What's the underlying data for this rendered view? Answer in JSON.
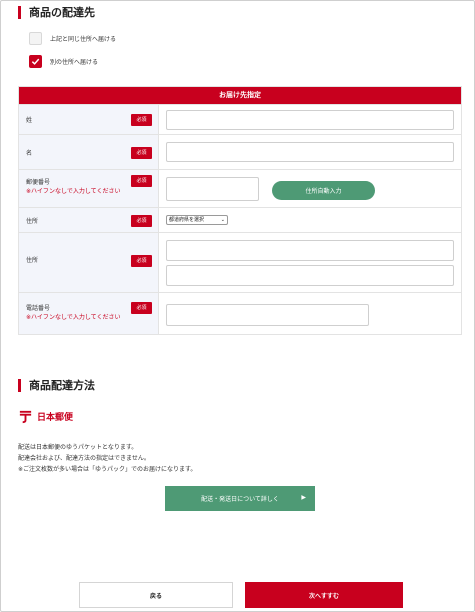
{
  "section1": {
    "title": "商品の配達先",
    "options": [
      {
        "label": "上記と同じ住所へ届ける",
        "checked": false
      },
      {
        "label": "別の住所へ届ける",
        "checked": true
      }
    ]
  },
  "form": {
    "header": "お届け先指定",
    "required_label": "必須",
    "rows": [
      {
        "label": "姓",
        "note": "",
        "value": ""
      },
      {
        "label": "名",
        "note": "",
        "value": ""
      },
      {
        "label": "郵便番号",
        "note": "※ハイフンなしで入力してください",
        "value": "",
        "button": "住所自動入力"
      },
      {
        "label": "住所",
        "note": "",
        "select": "都道府県を選択"
      },
      {
        "label": "住所",
        "note": "",
        "value1": "",
        "value2": ""
      },
      {
        "label": "電話番号",
        "note": "※ハイフンなしで入力してください",
        "value": ""
      }
    ]
  },
  "section2": {
    "title": "商品配達方法",
    "logo_text": "日本郵便",
    "info": [
      "配送は日本郵便のゆうパケットとなります。",
      "配達会社および、配達方法の指定はできません。",
      "※ご注文枚数が多い場合は「ゆうパック」でのお届けになります。"
    ],
    "detail_button": "配送・発送日について詳しく"
  },
  "footer": {
    "back_label": "戻る",
    "next_label": "次へすすむ"
  },
  "colors": {
    "brand": "#c8001e",
    "accent_green": "#4e9a75",
    "label_bg": "#f3f5fb"
  }
}
